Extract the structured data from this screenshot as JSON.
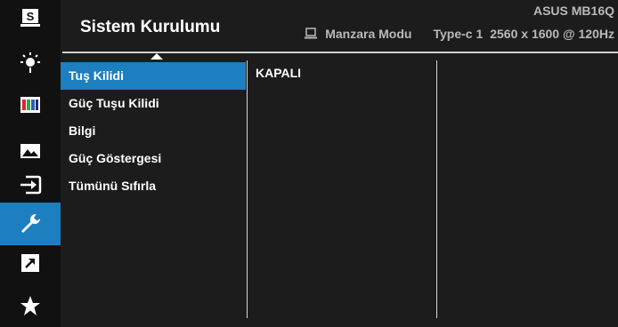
{
  "header": {
    "title": "Sistem Kurulumu",
    "model": "ASUS MB16Q",
    "mode": "Manzara Modu",
    "input": "Type-c 1",
    "resolution": "2560 x 1600 @ 120Hz"
  },
  "sidebar": {
    "items": [
      {
        "name": "splendid",
        "icon": "splendid-s-icon"
      },
      {
        "name": "blue-light-filter",
        "icon": "blue-light-filter-icon"
      },
      {
        "name": "color",
        "icon": "color-bars-icon"
      },
      {
        "name": "image",
        "icon": "image-mountain-icon"
      },
      {
        "name": "input-select",
        "icon": "input-select-icon"
      },
      {
        "name": "system-setup",
        "icon": "wrench-icon",
        "active": true
      },
      {
        "name": "shortcut",
        "icon": "shortcut-arrow-icon"
      },
      {
        "name": "myfavorite",
        "icon": "star-icon"
      }
    ]
  },
  "menu": {
    "items": [
      {
        "label": "Tuş Kilidi",
        "selected": true
      },
      {
        "label": "Güç Tuşu Kilidi"
      },
      {
        "label": "Bilgi"
      },
      {
        "label": "Güç Göstergesi"
      },
      {
        "label": "Tümünü Sıfırla"
      }
    ]
  },
  "submenu": {
    "value": "KAPALI"
  },
  "colors": {
    "accent": "#1e7fc0",
    "background": "#1c1c1c",
    "sidebar": "#111111",
    "text": "#ffffff",
    "muted_text": "#b9b9b9"
  }
}
